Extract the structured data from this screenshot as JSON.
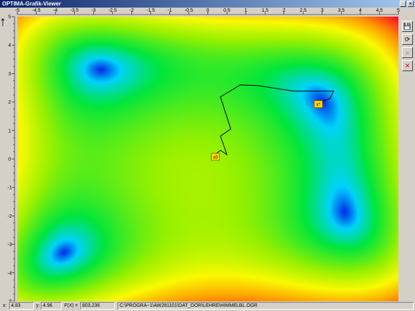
{
  "window": {
    "title": "OPTIMA-Grafik-Viewer",
    "close_glyph": "×",
    "minimize_glyph": "_"
  },
  "axes": {
    "top_ticks": [
      "-5",
      "-4.5",
      "-4",
      "-3.5",
      "-3",
      "-2.5",
      "-2",
      "-1.5",
      "-1",
      "-0.5",
      "0",
      "0.5",
      "1",
      "1.5",
      "2",
      "2.5",
      "3",
      "3.5",
      "4",
      "4.5",
      "5"
    ],
    "left_ticks": [
      "5",
      "4",
      "3",
      "2",
      "1",
      "0",
      "-1",
      "-2",
      "-3",
      "-4",
      "-5"
    ]
  },
  "chart_data": {
    "type": "heatmap",
    "x_range": [
      -5,
      5
    ],
    "y_range": [
      -5,
      5
    ],
    "minima": [
      {
        "x": 3.0,
        "y": 2.0
      },
      {
        "x": -2.8,
        "y": 3.13
      },
      {
        "x": -3.78,
        "y": -3.28
      },
      {
        "x": 3.58,
        "y": -1.85
      }
    ],
    "start_marker": {
      "label": "x0",
      "x": 0.2,
      "y": 0.05
    },
    "end_marker": {
      "label": "x*",
      "x": 2.9,
      "y": 1.9
    },
    "search_path": [
      {
        "x": 0.08,
        "y": 0.05
      },
      {
        "x": 0.33,
        "y": 0.3
      },
      {
        "x": 0.5,
        "y": 0.15
      },
      {
        "x": 0.33,
        "y": 0.8
      },
      {
        "x": 0.6,
        "y": 1.05
      },
      {
        "x": 0.33,
        "y": 2.18
      },
      {
        "x": 0.85,
        "y": 2.6
      },
      {
        "x": 1.3,
        "y": 2.58
      },
      {
        "x": 2.25,
        "y": 2.38
      },
      {
        "x": 3.3,
        "y": 2.38
      },
      {
        "x": 3.2,
        "y": 2.12
      },
      {
        "x": 3.05,
        "y": 2.05
      },
      {
        "x": 2.95,
        "y": 1.95
      }
    ]
  },
  "toolbar": [
    {
      "name": "save-icon",
      "glyph": "💾"
    },
    {
      "name": "refresh-icon",
      "glyph": "⟳"
    },
    {
      "name": "forward-icon",
      "glyph": "»"
    },
    {
      "name": "close-icon",
      "glyph": "✕"
    }
  ],
  "status": {
    "x_label": "x:",
    "x_value": "4.83",
    "y_label": "y:",
    "y_value": "4.96",
    "f_label": "F(X) =",
    "f_value": "803.236",
    "file_path": "C:\\PROGRA~1\\AW281101\\DAT_OOR\\LEHRE\\HIMMELBL.OGR"
  }
}
